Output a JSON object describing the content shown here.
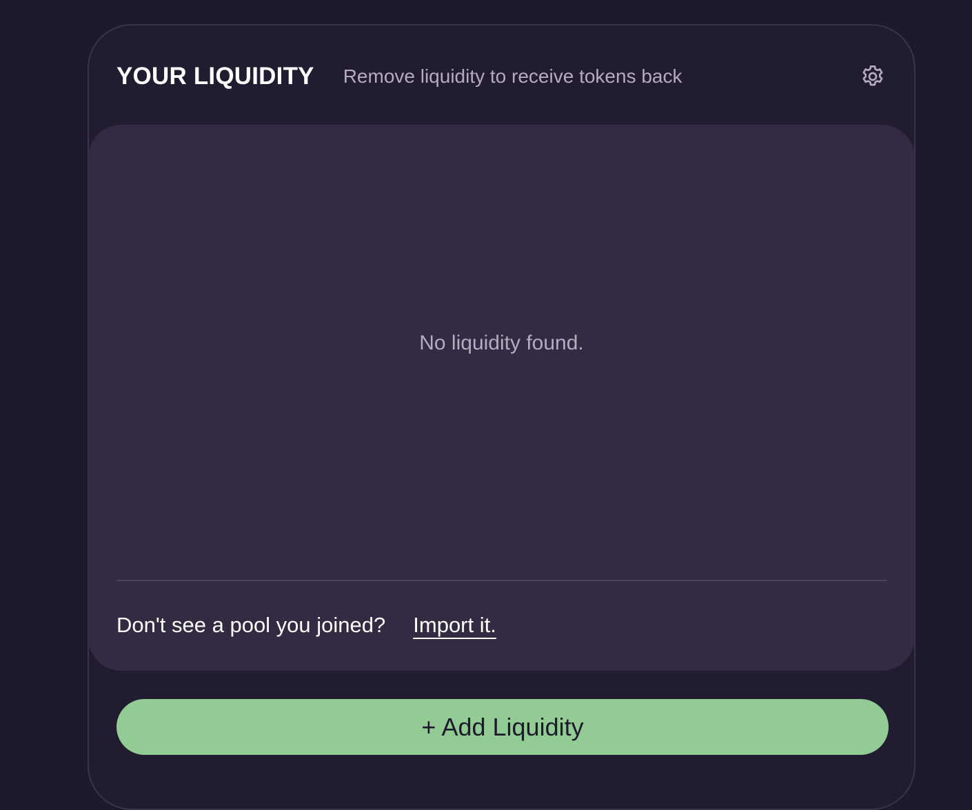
{
  "header": {
    "title": "YOUR LIQUIDITY",
    "subtitle": "Remove liquidity to receive tokens back",
    "settings_icon": "gear-icon"
  },
  "panel": {
    "empty_message": "No liquidity found.",
    "import_prompt": "Don't see a pool you joined?",
    "import_link": "Import it."
  },
  "actions": {
    "add_liquidity_label": "+ Add Liquidity"
  },
  "colors": {
    "background": "#1e1a2e",
    "card": "#221c31",
    "panel": "#322b42",
    "accent_button": "#93cb94",
    "muted_text": "#b3adbf"
  }
}
